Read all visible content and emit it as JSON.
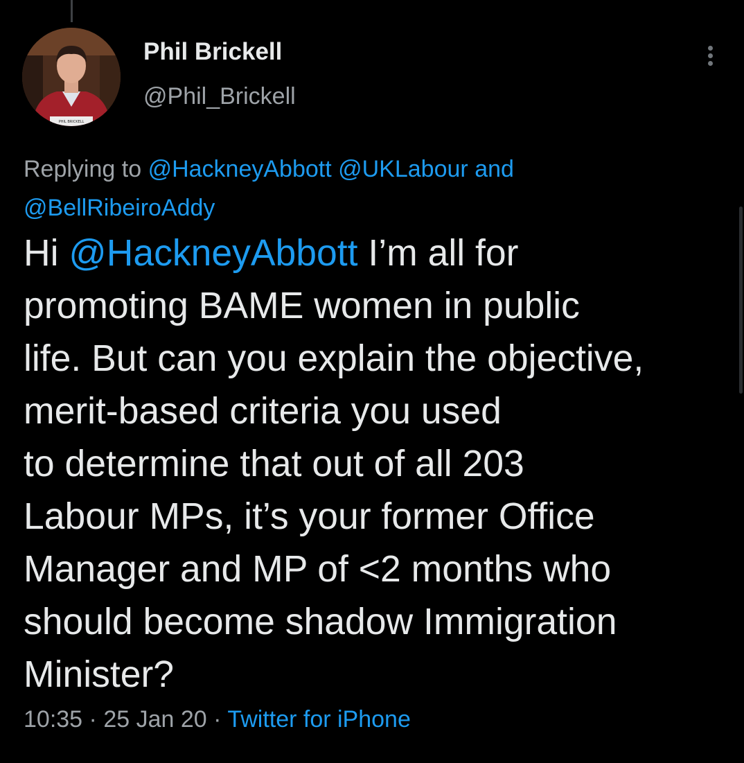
{
  "author": {
    "name": "Phil Brickell",
    "handle": "@Phil_Brickell",
    "avatar_caption": "PHIL BRICKELL"
  },
  "menu": {
    "icon": "more-vertical-icon"
  },
  "reply": {
    "prefix": "Replying to",
    "mention_1": "@HackneyAbbott",
    "mention_2": "@UKLabour",
    "joiner": "and",
    "mention_3": "@BellRibeiroAddy"
  },
  "tweet": {
    "greeting": "Hi",
    "mention": "@HackneyAbbott",
    "line_1_rest": "I’m all for",
    "line_2": "promoting BAME women in public",
    "line_3": "life. But can you explain the objective,",
    "line_4": "merit-based criteria you used",
    "line_5": "to determine that out of all 203",
    "line_6": "Labour MPs, it’s your former Office",
    "line_7": "Manager and MP of <2 months who",
    "line_8": "should become shadow Immigration",
    "line_9": "Minister?"
  },
  "meta": {
    "time": "10:35",
    "date": "25 Jan 20",
    "separator": "·",
    "source": "Twitter for iPhone"
  },
  "colors": {
    "background": "#000000",
    "text": "#e7e9ea",
    "secondary": "#9ea3a8",
    "link": "#1d9bf0"
  }
}
